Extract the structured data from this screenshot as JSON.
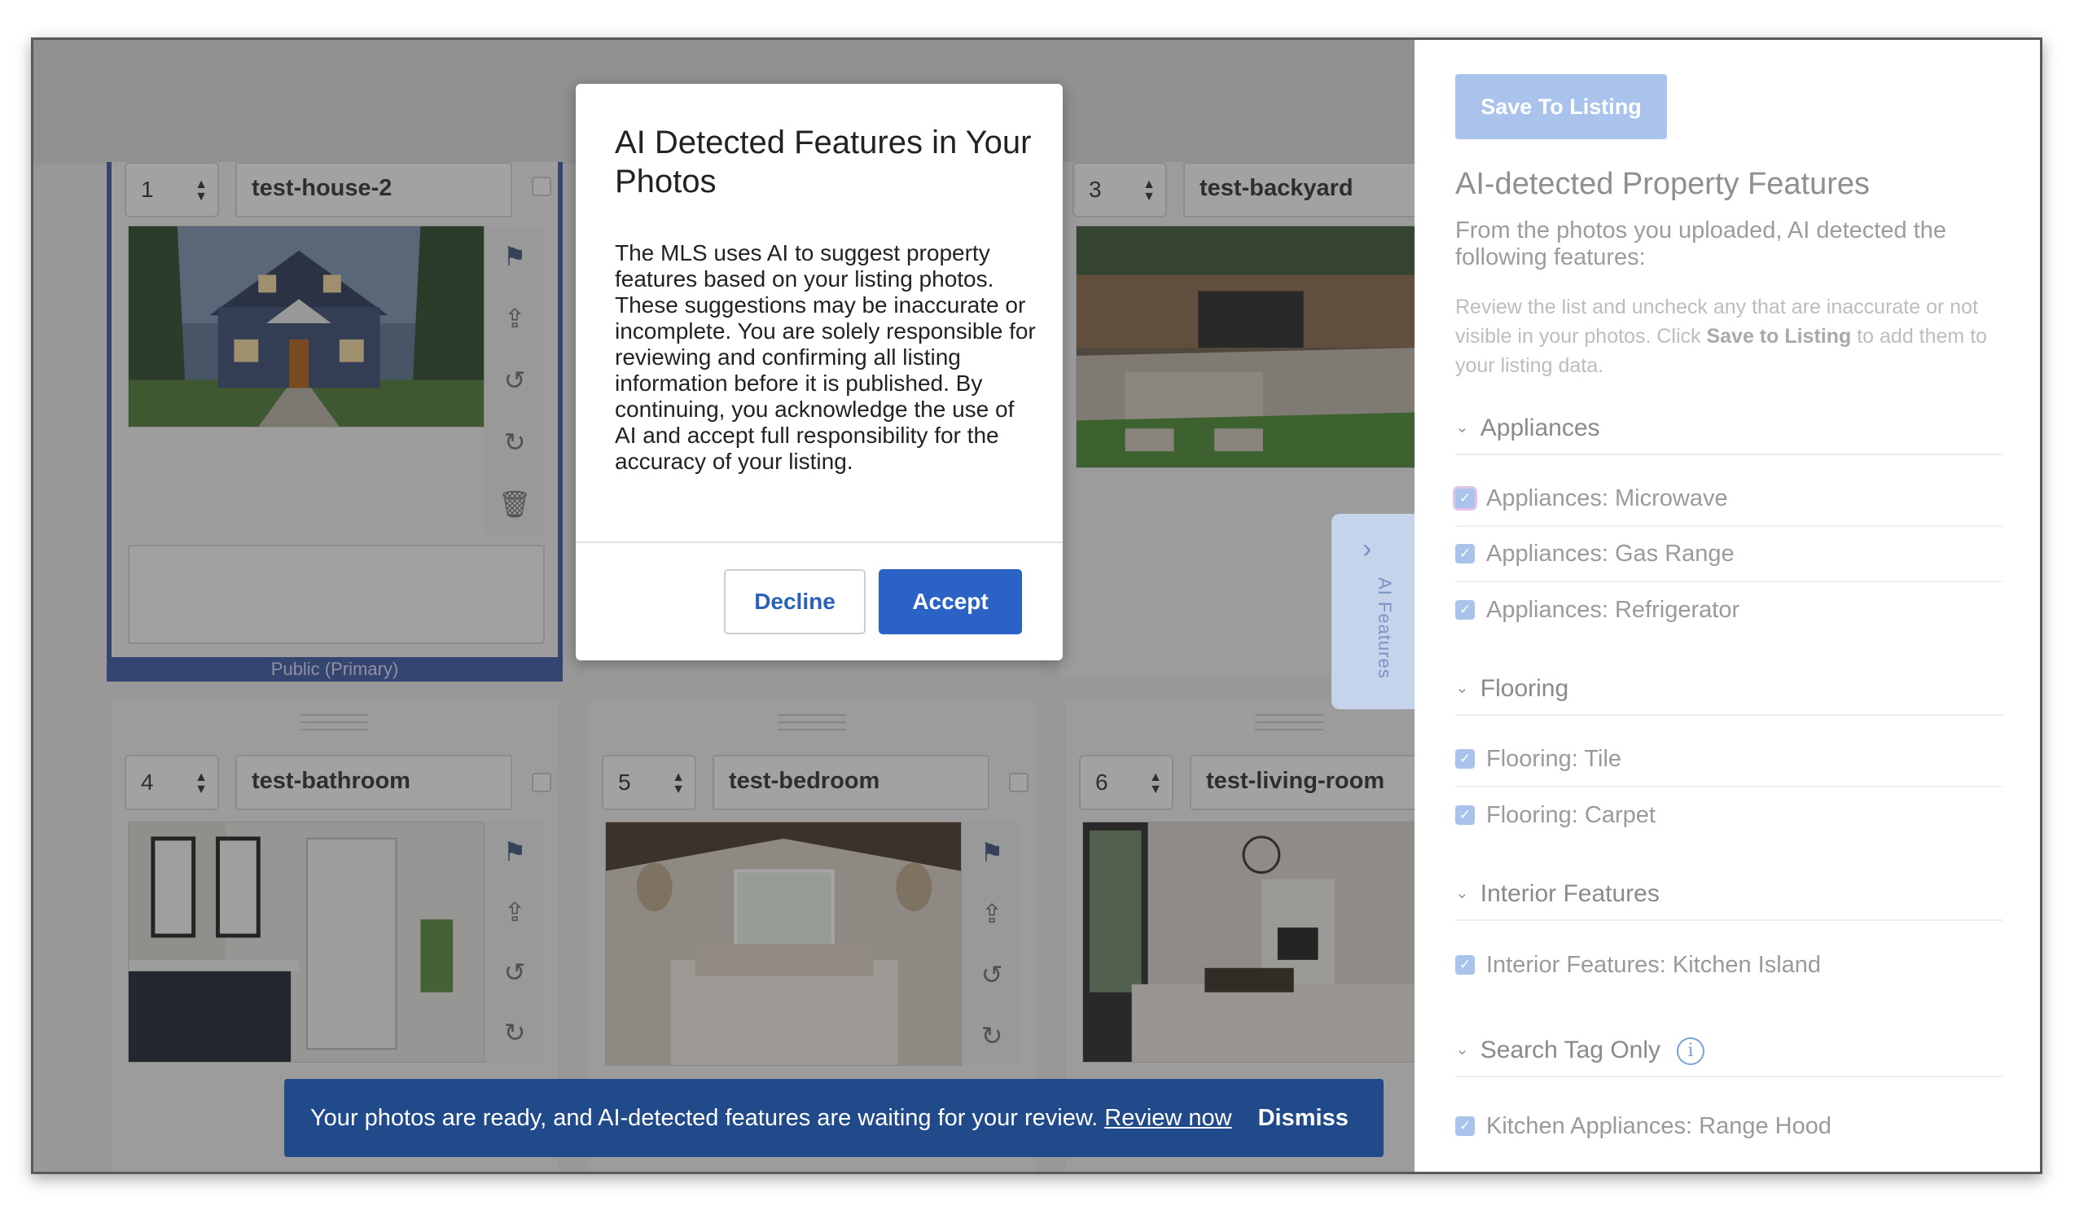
{
  "cards": [
    {
      "number": "1",
      "name": "test-house-2",
      "label": "Public (Primary)"
    },
    {
      "number": "3",
      "name": "test-backyard"
    },
    {
      "number": "4",
      "name": "test-bathroom"
    },
    {
      "number": "5",
      "name": "test-bedroom"
    },
    {
      "number": "6",
      "name": "test-living-room"
    }
  ],
  "ai_tab": {
    "label": "AI Features"
  },
  "modal": {
    "title": "AI Detected Features in Your Photos",
    "body": "The MLS uses AI to suggest property features based on your listing photos. These suggestions may be inaccurate or incomplete. You are solely responsible for reviewing and confirming all listing information before it is published. By continuing, you acknowledge the use of AI and accept full responsibility for the accuracy of your listing.",
    "decline_label": "Decline",
    "accept_label": "Accept"
  },
  "toast": {
    "message": "Your photos are ready, and AI-detected features are waiting for your review.",
    "link": "Review now",
    "dismiss": "Dismiss"
  },
  "panel": {
    "save_label": "Save To Listing",
    "title": "AI-detected Property Features",
    "subtitle": "From the photos you uploaded, AI detected the following features:",
    "hint_pre": "Review the list and uncheck any that are inaccurate or not visible in your photos. Click ",
    "hint_bold": "Save to Listing",
    "hint_post": " to add them to your listing data.",
    "sections": [
      {
        "title": "Appliances",
        "items": [
          "Appliances: Microwave",
          "Appliances: Gas Range",
          "Appliances: Refrigerator"
        ]
      },
      {
        "title": "Flooring",
        "items": [
          "Flooring: Tile",
          "Flooring: Carpet"
        ]
      },
      {
        "title": "Interior Features",
        "items": [
          "Interior Features: Kitchen Island"
        ]
      },
      {
        "title": "Search Tag Only",
        "items": [
          "Kitchen Appliances: Range Hood"
        ]
      }
    ]
  },
  "colors": {
    "primary_blue": "#2a62c6",
    "toast_bg": "#204a89",
    "save_btn": "#a9c3ec"
  }
}
